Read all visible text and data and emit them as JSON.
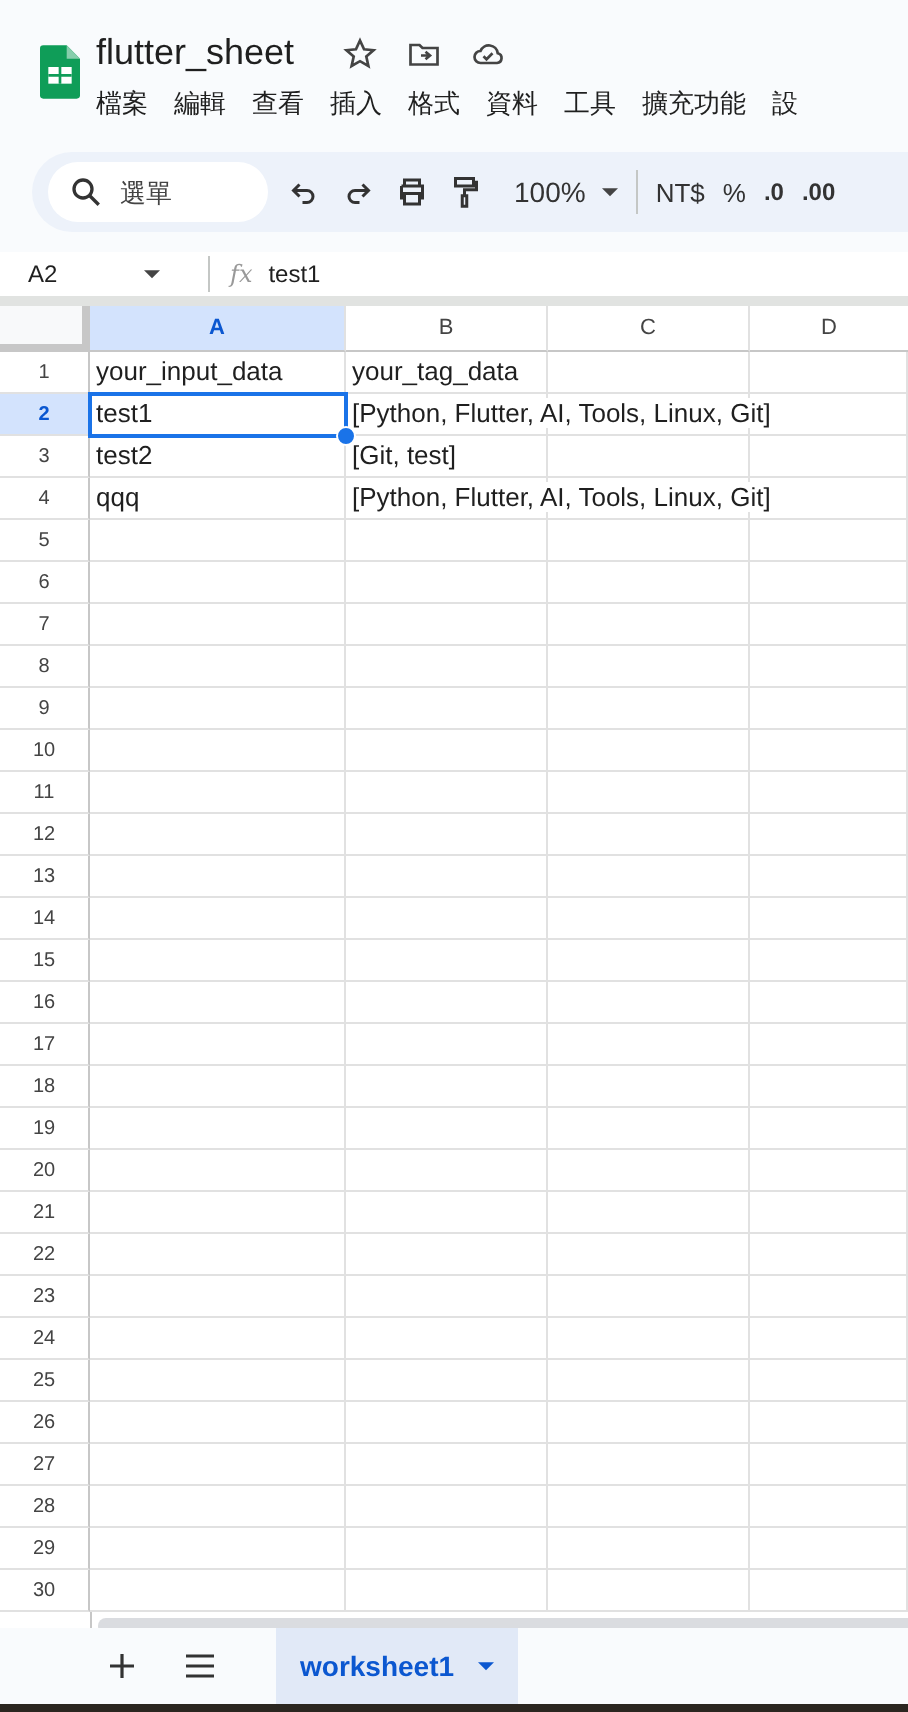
{
  "doc": {
    "title": "flutter_sheet"
  },
  "menu": [
    "檔案",
    "編輯",
    "查看",
    "插入",
    "格式",
    "資料",
    "工具",
    "擴充功能",
    "設"
  ],
  "toolbar": {
    "search_placeholder": "選單",
    "zoom": "100%",
    "currency": "NT$",
    "percent": "%",
    "dec_decrease": ".0",
    "dec_increase": ".00"
  },
  "formula_bar": {
    "cell_ref": "A2",
    "fx_label": "fx",
    "value": "test1"
  },
  "columns": [
    {
      "label": "A",
      "selected": true
    },
    {
      "label": "B",
      "selected": false
    },
    {
      "label": "C",
      "selected": false
    },
    {
      "label": "D",
      "selected": false
    }
  ],
  "rows": [
    {
      "number": "1",
      "selected": false,
      "cells": [
        {
          "text": "your_input_data",
          "active": false
        },
        {
          "text": "your_tag_data",
          "active": false
        }
      ]
    },
    {
      "number": "2",
      "selected": true,
      "cells": [
        {
          "text": "test1",
          "active": true
        },
        {
          "text": "[Python, Flutter, AI, Tools, Linux, Git]",
          "active": false
        }
      ]
    },
    {
      "number": "3",
      "selected": false,
      "cells": [
        {
          "text": "test2",
          "active": false
        },
        {
          "text": "[Git, test]",
          "active": false
        }
      ]
    },
    {
      "number": "4",
      "selected": false,
      "cells": [
        {
          "text": "qqq",
          "active": false
        },
        {
          "text": "[Python, Flutter, AI, Tools, Linux, Git]",
          "active": false
        }
      ]
    },
    {
      "number": "5",
      "selected": false
    },
    {
      "number": "6",
      "selected": false
    },
    {
      "number": "7",
      "selected": false
    },
    {
      "number": "8",
      "selected": false
    },
    {
      "number": "9",
      "selected": false
    },
    {
      "number": "10",
      "selected": false
    },
    {
      "number": "11",
      "selected": false
    },
    {
      "number": "12",
      "selected": false
    },
    {
      "number": "13",
      "selected": false
    },
    {
      "number": "14",
      "selected": false
    },
    {
      "number": "15",
      "selected": false
    },
    {
      "number": "16",
      "selected": false
    },
    {
      "number": "17",
      "selected": false
    },
    {
      "number": "18",
      "selected": false
    },
    {
      "number": "19",
      "selected": false
    },
    {
      "number": "20",
      "selected": false
    },
    {
      "number": "21",
      "selected": false
    },
    {
      "number": "22",
      "selected": false
    },
    {
      "number": "23",
      "selected": false
    },
    {
      "number": "24",
      "selected": false
    },
    {
      "number": "25",
      "selected": false
    },
    {
      "number": "26",
      "selected": false
    },
    {
      "number": "27",
      "selected": false
    },
    {
      "number": "28",
      "selected": false
    },
    {
      "number": "29",
      "selected": false
    },
    {
      "number": "30",
      "selected": false
    }
  ],
  "sheets": [
    {
      "name": "worksheet1",
      "selected": true
    }
  ]
}
